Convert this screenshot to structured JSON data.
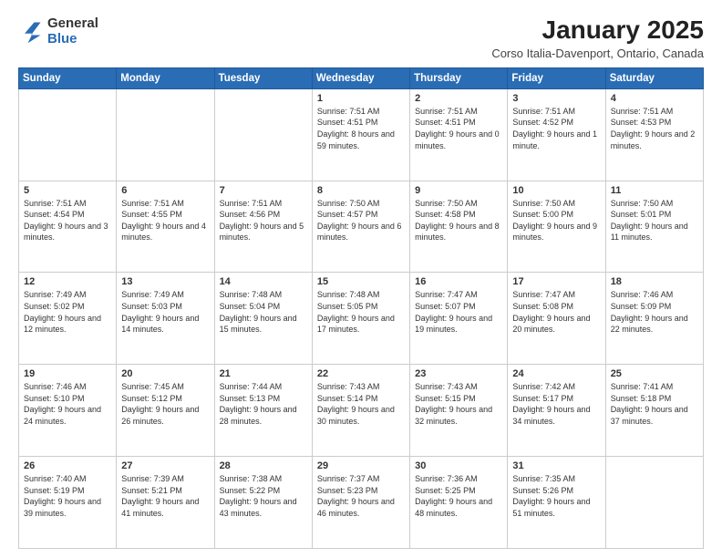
{
  "header": {
    "logo": {
      "line1": "General",
      "line2": "Blue"
    },
    "title": "January 2025",
    "location": "Corso Italia-Davenport, Ontario, Canada"
  },
  "calendar": {
    "weekdays": [
      "Sunday",
      "Monday",
      "Tuesday",
      "Wednesday",
      "Thursday",
      "Friday",
      "Saturday"
    ],
    "weeks": [
      [
        {
          "day": "",
          "info": ""
        },
        {
          "day": "",
          "info": ""
        },
        {
          "day": "",
          "info": ""
        },
        {
          "day": "1",
          "info": "Sunrise: 7:51 AM\nSunset: 4:51 PM\nDaylight: 8 hours and 59 minutes."
        },
        {
          "day": "2",
          "info": "Sunrise: 7:51 AM\nSunset: 4:51 PM\nDaylight: 9 hours and 0 minutes."
        },
        {
          "day": "3",
          "info": "Sunrise: 7:51 AM\nSunset: 4:52 PM\nDaylight: 9 hours and 1 minute."
        },
        {
          "day": "4",
          "info": "Sunrise: 7:51 AM\nSunset: 4:53 PM\nDaylight: 9 hours and 2 minutes."
        }
      ],
      [
        {
          "day": "5",
          "info": "Sunrise: 7:51 AM\nSunset: 4:54 PM\nDaylight: 9 hours and 3 minutes."
        },
        {
          "day": "6",
          "info": "Sunrise: 7:51 AM\nSunset: 4:55 PM\nDaylight: 9 hours and 4 minutes."
        },
        {
          "day": "7",
          "info": "Sunrise: 7:51 AM\nSunset: 4:56 PM\nDaylight: 9 hours and 5 minutes."
        },
        {
          "day": "8",
          "info": "Sunrise: 7:50 AM\nSunset: 4:57 PM\nDaylight: 9 hours and 6 minutes."
        },
        {
          "day": "9",
          "info": "Sunrise: 7:50 AM\nSunset: 4:58 PM\nDaylight: 9 hours and 8 minutes."
        },
        {
          "day": "10",
          "info": "Sunrise: 7:50 AM\nSunset: 5:00 PM\nDaylight: 9 hours and 9 minutes."
        },
        {
          "day": "11",
          "info": "Sunrise: 7:50 AM\nSunset: 5:01 PM\nDaylight: 9 hours and 11 minutes."
        }
      ],
      [
        {
          "day": "12",
          "info": "Sunrise: 7:49 AM\nSunset: 5:02 PM\nDaylight: 9 hours and 12 minutes."
        },
        {
          "day": "13",
          "info": "Sunrise: 7:49 AM\nSunset: 5:03 PM\nDaylight: 9 hours and 14 minutes."
        },
        {
          "day": "14",
          "info": "Sunrise: 7:48 AM\nSunset: 5:04 PM\nDaylight: 9 hours and 15 minutes."
        },
        {
          "day": "15",
          "info": "Sunrise: 7:48 AM\nSunset: 5:05 PM\nDaylight: 9 hours and 17 minutes."
        },
        {
          "day": "16",
          "info": "Sunrise: 7:47 AM\nSunset: 5:07 PM\nDaylight: 9 hours and 19 minutes."
        },
        {
          "day": "17",
          "info": "Sunrise: 7:47 AM\nSunset: 5:08 PM\nDaylight: 9 hours and 20 minutes."
        },
        {
          "day": "18",
          "info": "Sunrise: 7:46 AM\nSunset: 5:09 PM\nDaylight: 9 hours and 22 minutes."
        }
      ],
      [
        {
          "day": "19",
          "info": "Sunrise: 7:46 AM\nSunset: 5:10 PM\nDaylight: 9 hours and 24 minutes."
        },
        {
          "day": "20",
          "info": "Sunrise: 7:45 AM\nSunset: 5:12 PM\nDaylight: 9 hours and 26 minutes."
        },
        {
          "day": "21",
          "info": "Sunrise: 7:44 AM\nSunset: 5:13 PM\nDaylight: 9 hours and 28 minutes."
        },
        {
          "day": "22",
          "info": "Sunrise: 7:43 AM\nSunset: 5:14 PM\nDaylight: 9 hours and 30 minutes."
        },
        {
          "day": "23",
          "info": "Sunrise: 7:43 AM\nSunset: 5:15 PM\nDaylight: 9 hours and 32 minutes."
        },
        {
          "day": "24",
          "info": "Sunrise: 7:42 AM\nSunset: 5:17 PM\nDaylight: 9 hours and 34 minutes."
        },
        {
          "day": "25",
          "info": "Sunrise: 7:41 AM\nSunset: 5:18 PM\nDaylight: 9 hours and 37 minutes."
        }
      ],
      [
        {
          "day": "26",
          "info": "Sunrise: 7:40 AM\nSunset: 5:19 PM\nDaylight: 9 hours and 39 minutes."
        },
        {
          "day": "27",
          "info": "Sunrise: 7:39 AM\nSunset: 5:21 PM\nDaylight: 9 hours and 41 minutes."
        },
        {
          "day": "28",
          "info": "Sunrise: 7:38 AM\nSunset: 5:22 PM\nDaylight: 9 hours and 43 minutes."
        },
        {
          "day": "29",
          "info": "Sunrise: 7:37 AM\nSunset: 5:23 PM\nDaylight: 9 hours and 46 minutes."
        },
        {
          "day": "30",
          "info": "Sunrise: 7:36 AM\nSunset: 5:25 PM\nDaylight: 9 hours and 48 minutes."
        },
        {
          "day": "31",
          "info": "Sunrise: 7:35 AM\nSunset: 5:26 PM\nDaylight: 9 hours and 51 minutes."
        },
        {
          "day": "",
          "info": ""
        }
      ]
    ]
  }
}
